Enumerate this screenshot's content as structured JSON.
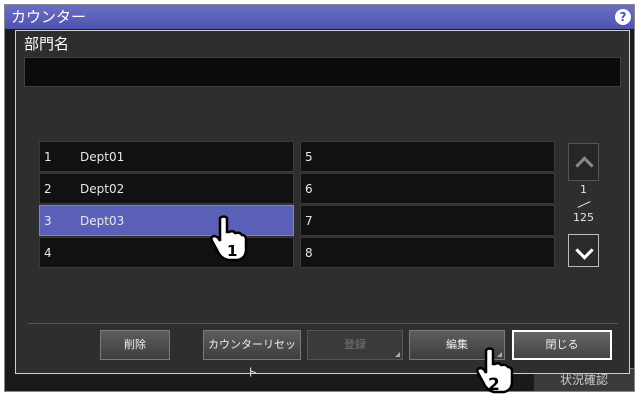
{
  "window": {
    "title": "カウンター",
    "help": "?",
    "status_button": "状況確認"
  },
  "dialog": {
    "title": "部門名",
    "name_value": "",
    "left_rows": [
      {
        "num": "1",
        "name": "Dept01"
      },
      {
        "num": "2",
        "name": "Dept02"
      },
      {
        "num": "3",
        "name": "Dept03"
      },
      {
        "num": "4",
        "name": ""
      }
    ],
    "right_rows": [
      {
        "num": "5",
        "name": ""
      },
      {
        "num": "6",
        "name": ""
      },
      {
        "num": "7",
        "name": ""
      },
      {
        "num": "8",
        "name": ""
      }
    ],
    "selected_row": "3",
    "page": {
      "current": "1",
      "total": "125"
    },
    "buttons": {
      "delete": "削除",
      "counter_reset": "カウンターリセット",
      "register": "登録",
      "edit": "編集",
      "close": "閉じる"
    }
  },
  "callouts": {
    "step1": "1",
    "step2": "2"
  },
  "colors": {
    "selected": "#5a60b8",
    "title_bar": "#4d52ad"
  }
}
